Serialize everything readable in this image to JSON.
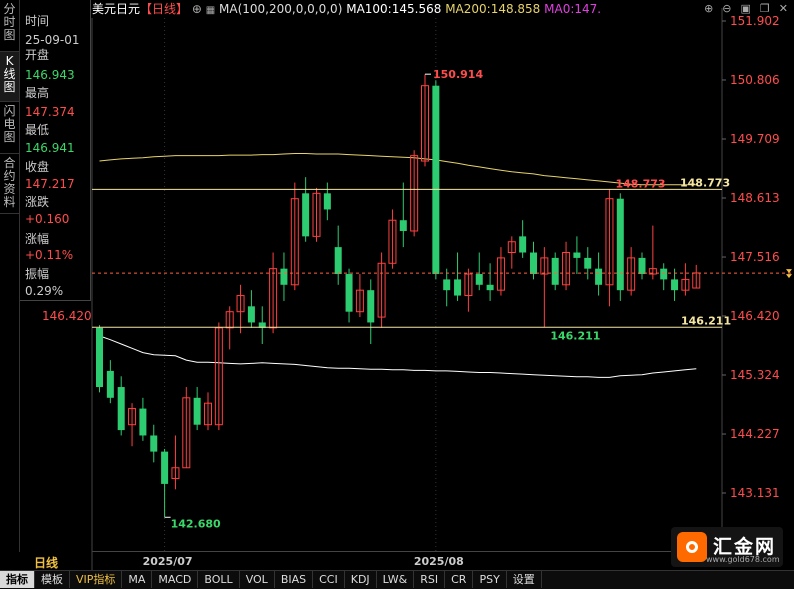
{
  "side_tabs": [
    {
      "label": "分时图",
      "active": false
    },
    {
      "label": "K线图",
      "active": true
    },
    {
      "label": "闪电图",
      "active": false
    },
    {
      "label": "合约资料",
      "active": false
    }
  ],
  "info_panel": {
    "time_label": "时间",
    "time_value": "25-09-01",
    "open_label": "开盘",
    "open_value": "146.943",
    "high_label": "最高",
    "high_value": "147.374",
    "low_label": "最低",
    "low_value": "146.941",
    "close_label": "收盘",
    "close_value": "147.217",
    "change_label": "涨跌",
    "change_value": "+0.160",
    "pct_label": "涨幅",
    "pct_value": "+0.11%",
    "amp_label": "振幅",
    "amp_value": "0.29%"
  },
  "header": {
    "symbol": "美元日元",
    "period": "【日线】",
    "ma_params": "MA(100,200,0,0,0,0)",
    "ma100": "MA100:145.568",
    "ma200": "MA200:148.858",
    "ma0": "MA0:147."
  },
  "price_axis": [
    "151.902",
    "150.806",
    "149.709",
    "148.613",
    "147.516",
    "146.420",
    "145.324",
    "144.227",
    "143.131"
  ],
  "left_axis_label": "146.420",
  "date_labels": [
    "2025/07",
    "2025/08"
  ],
  "annotations": {
    "high": "150.914",
    "low": "142.680",
    "r1": "148.773",
    "r2": "148.773",
    "s1": "146.211",
    "s2": "146.211"
  },
  "bottom_tabs": [
    "指标",
    "模板",
    "VIP指标",
    "MA",
    "MACD",
    "BOLL",
    "VOL",
    "BIAS",
    "CCI",
    "KDJ",
    "LW&",
    "RSI",
    "CR",
    "PSY",
    "设置"
  ],
  "period_label": "日线",
  "logo": {
    "text": "汇金网",
    "url": "www.gold678.com"
  },
  "colors": {
    "up": "#ff4040",
    "down": "#2ecc71",
    "ma100": "#ffffff",
    "ma200": "#e6d36a",
    "hline": "#f5e6a0"
  },
  "chart_data": {
    "type": "candlestick",
    "price_range": [
      142.5,
      152.3
    ],
    "candles": [
      {
        "o": 146.2,
        "h": 146.25,
        "l": 145.0,
        "c": 145.1
      },
      {
        "o": 145.4,
        "h": 145.6,
        "l": 144.8,
        "c": 144.9
      },
      {
        "o": 145.1,
        "h": 145.3,
        "l": 144.2,
        "c": 144.3
      },
      {
        "o": 144.4,
        "h": 144.8,
        "l": 144.0,
        "c": 144.7
      },
      {
        "o": 144.7,
        "h": 144.9,
        "l": 144.1,
        "c": 144.2
      },
      {
        "o": 144.2,
        "h": 144.4,
        "l": 143.7,
        "c": 143.9
      },
      {
        "o": 143.9,
        "h": 143.95,
        "l": 142.68,
        "c": 143.3
      },
      {
        "o": 143.4,
        "h": 144.2,
        "l": 143.2,
        "c": 143.6
      },
      {
        "o": 143.6,
        "h": 145.1,
        "l": 143.6,
        "c": 144.9
      },
      {
        "o": 144.9,
        "h": 145.1,
        "l": 144.3,
        "c": 144.4
      },
      {
        "o": 144.4,
        "h": 145.0,
        "l": 144.3,
        "c": 144.8
      },
      {
        "o": 144.4,
        "h": 146.3,
        "l": 144.3,
        "c": 146.2
      },
      {
        "o": 146.2,
        "h": 146.6,
        "l": 145.8,
        "c": 146.5
      },
      {
        "o": 146.5,
        "h": 147.0,
        "l": 146.1,
        "c": 146.8
      },
      {
        "o": 146.6,
        "h": 146.9,
        "l": 146.2,
        "c": 146.3
      },
      {
        "o": 146.3,
        "h": 146.6,
        "l": 145.9,
        "c": 146.2
      },
      {
        "o": 146.2,
        "h": 147.6,
        "l": 146.1,
        "c": 147.3
      },
      {
        "o": 147.3,
        "h": 147.6,
        "l": 146.7,
        "c": 147.0
      },
      {
        "o": 147.0,
        "h": 148.9,
        "l": 146.9,
        "c": 148.6
      },
      {
        "o": 148.7,
        "h": 149.0,
        "l": 147.8,
        "c": 147.9
      },
      {
        "o": 147.9,
        "h": 148.8,
        "l": 147.8,
        "c": 148.7
      },
      {
        "o": 148.7,
        "h": 148.9,
        "l": 148.2,
        "c": 148.4
      },
      {
        "o": 147.7,
        "h": 148.1,
        "l": 147.0,
        "c": 147.2
      },
      {
        "o": 147.2,
        "h": 147.3,
        "l": 146.3,
        "c": 146.5
      },
      {
        "o": 146.5,
        "h": 147.2,
        "l": 146.4,
        "c": 146.9
      },
      {
        "o": 146.9,
        "h": 147.1,
        "l": 145.9,
        "c": 146.3
      },
      {
        "o": 146.4,
        "h": 147.6,
        "l": 146.2,
        "c": 147.4
      },
      {
        "o": 147.4,
        "h": 148.4,
        "l": 147.3,
        "c": 148.2
      },
      {
        "o": 148.2,
        "h": 148.9,
        "l": 147.7,
        "c": 148.0
      },
      {
        "o": 148.0,
        "h": 149.5,
        "l": 147.9,
        "c": 149.4
      },
      {
        "o": 149.3,
        "h": 150.91,
        "l": 149.2,
        "c": 150.7
      },
      {
        "o": 150.7,
        "h": 150.8,
        "l": 147.1,
        "c": 147.2
      },
      {
        "o": 147.1,
        "h": 147.3,
        "l": 146.6,
        "c": 146.9
      },
      {
        "o": 147.1,
        "h": 147.6,
        "l": 146.7,
        "c": 146.8
      },
      {
        "o": 146.8,
        "h": 147.3,
        "l": 146.5,
        "c": 147.2
      },
      {
        "o": 147.2,
        "h": 147.6,
        "l": 146.9,
        "c": 147.0
      },
      {
        "o": 147.0,
        "h": 147.4,
        "l": 146.7,
        "c": 146.9
      },
      {
        "o": 146.9,
        "h": 147.7,
        "l": 146.8,
        "c": 147.5
      },
      {
        "o": 147.6,
        "h": 147.9,
        "l": 147.3,
        "c": 147.8
      },
      {
        "o": 147.9,
        "h": 148.2,
        "l": 147.5,
        "c": 147.6
      },
      {
        "o": 147.6,
        "h": 147.8,
        "l": 147.1,
        "c": 147.2
      },
      {
        "o": 147.2,
        "h": 147.7,
        "l": 146.211,
        "c": 147.5
      },
      {
        "o": 147.5,
        "h": 147.6,
        "l": 146.9,
        "c": 147.0
      },
      {
        "o": 147.0,
        "h": 147.8,
        "l": 146.9,
        "c": 147.6
      },
      {
        "o": 147.6,
        "h": 147.9,
        "l": 147.2,
        "c": 147.5
      },
      {
        "o": 147.5,
        "h": 147.7,
        "l": 147.1,
        "c": 147.3
      },
      {
        "o": 147.3,
        "h": 147.6,
        "l": 146.8,
        "c": 147.0
      },
      {
        "o": 147.0,
        "h": 148.773,
        "l": 146.6,
        "c": 148.6
      },
      {
        "o": 148.6,
        "h": 148.7,
        "l": 146.7,
        "c": 146.9
      },
      {
        "o": 146.9,
        "h": 147.7,
        "l": 146.8,
        "c": 147.5
      },
      {
        "o": 147.5,
        "h": 147.6,
        "l": 147.1,
        "c": 147.2
      },
      {
        "o": 147.2,
        "h": 148.1,
        "l": 147.1,
        "c": 147.3
      },
      {
        "o": 147.3,
        "h": 147.4,
        "l": 146.9,
        "c": 147.1
      },
      {
        "o": 147.1,
        "h": 147.3,
        "l": 146.7,
        "c": 146.9
      },
      {
        "o": 146.9,
        "h": 147.4,
        "l": 146.8,
        "c": 147.1
      },
      {
        "o": 146.94,
        "h": 147.37,
        "l": 146.94,
        "c": 147.22
      }
    ],
    "ma100": [
      146.05,
      145.98,
      145.9,
      145.82,
      145.74,
      145.7,
      145.69,
      145.68,
      145.6,
      145.56,
      145.56,
      145.55,
      145.54,
      145.53,
      145.54,
      145.55,
      145.54,
      145.53,
      145.52,
      145.5,
      145.48,
      145.46,
      145.45,
      145.45,
      145.44,
      145.43,
      145.43,
      145.42,
      145.42,
      145.41,
      145.41,
      145.4,
      145.4,
      145.39,
      145.38,
      145.37,
      145.37,
      145.36,
      145.35,
      145.34,
      145.33,
      145.32,
      145.31,
      145.3,
      145.29,
      145.29,
      145.28,
      145.28,
      145.31,
      145.32,
      145.33,
      145.36,
      145.38,
      145.4,
      145.42,
      145.44
    ],
    "ma200": [
      149.3,
      149.32,
      149.34,
      149.35,
      149.36,
      149.38,
      149.39,
      149.4,
      149.4,
      149.4,
      149.4,
      149.4,
      149.41,
      149.41,
      149.41,
      149.42,
      149.42,
      149.43,
      149.44,
      149.44,
      149.43,
      149.43,
      149.43,
      149.42,
      149.41,
      149.4,
      149.39,
      149.38,
      149.37,
      149.36,
      149.34,
      149.32,
      149.29,
      149.26,
      149.22,
      149.19,
      149.16,
      149.13,
      149.1,
      149.08,
      149.06,
      149.03,
      149.01,
      148.99,
      148.97,
      148.95,
      148.93,
      148.91,
      148.89,
      148.87,
      148.86,
      148.86,
      148.86,
      148.86,
      148.86,
      148.86
    ],
    "hlines": [
      148.773,
      146.211
    ],
    "current_price": 147.217
  }
}
